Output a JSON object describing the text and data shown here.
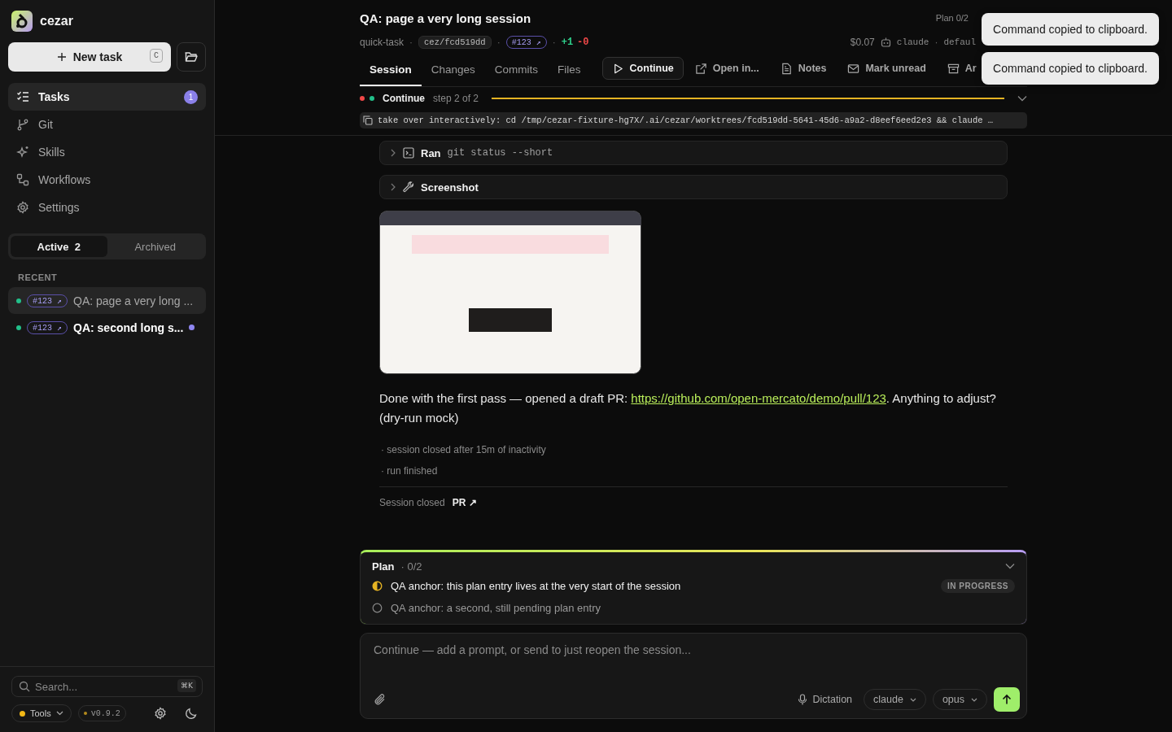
{
  "app": {
    "name": "cezar"
  },
  "sidebar": {
    "new_task": {
      "label": "New task",
      "shortcut": "C"
    },
    "nav": [
      {
        "label": "Tasks",
        "selected": true,
        "badge": "1"
      },
      {
        "label": "Git",
        "selected": false
      },
      {
        "label": "Skills",
        "selected": false
      },
      {
        "label": "Workflows",
        "selected": false
      },
      {
        "label": "Settings",
        "selected": false
      }
    ],
    "filter_tabs": [
      {
        "label": "Active",
        "count": "2",
        "selected": true
      },
      {
        "label": "Archived",
        "selected": false
      }
    ],
    "recent_heading": "RECENT",
    "recent": [
      {
        "tag": "#123 ↗",
        "title": "QA: page a very long ...",
        "selected": true,
        "unread": false
      },
      {
        "tag": "#123 ↗",
        "title": "QA: second long s...",
        "selected": false,
        "unread": true
      }
    ],
    "search": {
      "placeholder": "Search...",
      "shortcut": "⌘K"
    },
    "tools": {
      "label": "Tools"
    },
    "version": "v0.9.2"
  },
  "session": {
    "title": "QA: page a very long session",
    "plan_count": "Plan 0/2",
    "meta_left": [
      {
        "kind": "plain",
        "text": "quick-task"
      },
      {
        "kind": "sep",
        "text": "·"
      },
      {
        "kind": "branch",
        "text": "cez/fcd519dd"
      },
      {
        "kind": "sep",
        "text": "·"
      },
      {
        "kind": "pr",
        "text": "#123 ↗"
      },
      {
        "kind": "sep",
        "text": "·"
      },
      {
        "kind": "added",
        "text": "+1"
      },
      {
        "kind": "removed",
        "text": "-0"
      }
    ],
    "meta_right": [
      {
        "kind": "plain",
        "text": "$0.07"
      },
      {
        "kind": "mono",
        "text": "claude"
      },
      {
        "kind": "sep",
        "text": "·"
      },
      {
        "kind": "mono",
        "text": "defaul"
      }
    ],
    "tabs": [
      {
        "label": "Session",
        "selected": true
      },
      {
        "label": "Changes",
        "selected": false
      },
      {
        "label": "Commits",
        "selected": false
      },
      {
        "label": "Files",
        "selected": false
      }
    ],
    "actions": [
      {
        "label": "Continue",
        "primary": true
      },
      {
        "label": "Open in...",
        "primary": false
      },
      {
        "label": "Notes",
        "primary": false
      },
      {
        "label": "Mark unread",
        "primary": false
      },
      {
        "label": "Ar",
        "primary": false
      }
    ],
    "step": {
      "label": "Continue",
      "progress": "step 2 of 2"
    },
    "command": "take over interactively: cd /tmp/cezar-fixture-hg7X/.ai/cezar/worktrees/fcd519dd-5641-45d6-a9a2-d8eef6eed2e3 && claude …"
  },
  "transcript": {
    "tools": [
      {
        "verb": "Ran",
        "detail": "git status --short"
      },
      {
        "verb": "Screenshot"
      }
    ],
    "message": {
      "before": "Done with the first pass — opened a draft PR: ",
      "link": "https://github.com/open-mercato/demo/pull/123",
      "after": ". Anything to adjust? (dry-run mock)"
    },
    "events": [
      "· session closed after 15m of inactivity",
      "· run finished"
    ],
    "footer": {
      "label": "Session closed",
      "link": "PR ↗"
    }
  },
  "plan": {
    "title": "Plan",
    "count": "· 0/2",
    "items": [
      {
        "text": "QA anchor: this plan entry lives at the very start of the session",
        "kind": "active",
        "badge": "IN PROGRESS"
      },
      {
        "text": "QA anchor: a second, still pending plan entry",
        "kind": "pending"
      }
    ]
  },
  "composer": {
    "placeholder": "Continue — add a prompt, or send to just reopen the session...",
    "dictation": "Dictation",
    "agent": "claude",
    "model": "opus"
  },
  "toasts": [
    "Command copied to clipboard.",
    "Command copied to clipboard."
  ]
}
